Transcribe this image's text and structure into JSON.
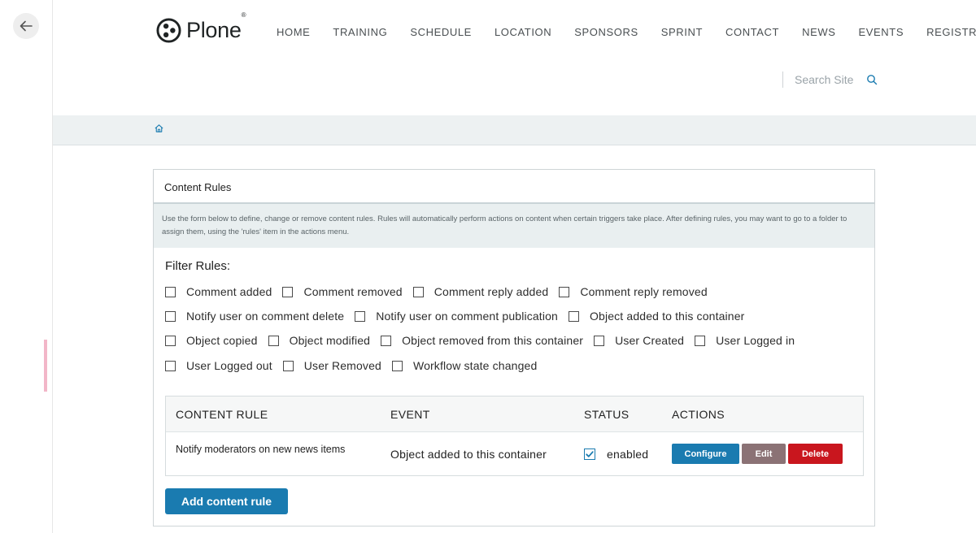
{
  "nav": {
    "logo_text": "Plone",
    "logo_reg": "®",
    "items": [
      "HOME",
      "TRAINING",
      "SCHEDULE",
      "LOCATION",
      "SPONSORS",
      "SPRINT",
      "CONTACT",
      "NEWS",
      "EVENTS",
      "REGISTRATION"
    ]
  },
  "search": {
    "placeholder": "Search Site"
  },
  "panel": {
    "title": "Content Rules",
    "description": "Use the form below to define, change or remove content rules. Rules will automatically perform actions on content when certain triggers take place. After defining rules, you may want to go to a folder to assign them, using the 'rules' item in the actions menu."
  },
  "filter": {
    "title": "Filter Rules:",
    "rows": [
      [
        "Comment added",
        "Comment removed",
        "Comment reply added",
        "Comment reply removed"
      ],
      [
        "Notify user on comment delete",
        "Notify user on comment publication",
        "Object added to this container"
      ],
      [
        "Object copied",
        "Object modified",
        "Object removed from this container",
        "User Created",
        "User Logged in"
      ],
      [
        "User Logged out",
        "User Removed",
        "Workflow state changed"
      ]
    ]
  },
  "table": {
    "headers": {
      "rule": "CONTENT RULE",
      "event": "EVENT",
      "status": "STATUS",
      "actions": "ACTIONS"
    },
    "rows": [
      {
        "rule": "Notify moderators on new news items",
        "event": "Object added to this container",
        "status": "enabled",
        "checked": true
      }
    ],
    "buttons": {
      "configure": "Configure",
      "edit": "Edit",
      "delete": "Delete"
    }
  },
  "add_button": "Add content rule",
  "colors": {
    "primary": "#1a7bb0",
    "edit": "#8b7275",
    "delete": "#c9161e"
  }
}
